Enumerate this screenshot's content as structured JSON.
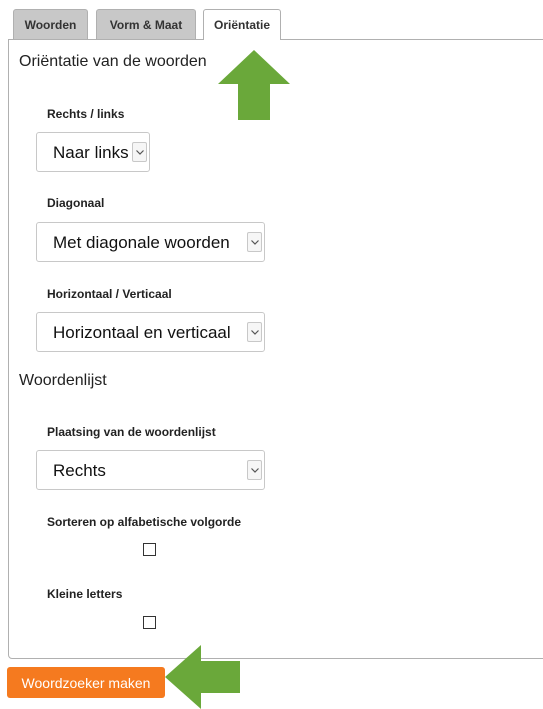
{
  "tabs": [
    {
      "label": "Woorden",
      "active": false
    },
    {
      "label": "Vorm & Maat",
      "active": false
    },
    {
      "label": "Oriëntatie",
      "active": true
    }
  ],
  "orientation": {
    "title": "Oriëntatie van de woorden",
    "right_left": {
      "label": "Rechts / links",
      "value": "Naar links"
    },
    "diagonal": {
      "label": "Diagonaal",
      "value": "Met diagonale woorden"
    },
    "horizontal_vertical": {
      "label": "Horizontaal / Verticaal",
      "value": "Horizontaal en verticaal"
    }
  },
  "word_list": {
    "title": "Woordenlijst",
    "placement": {
      "label": "Plaatsing van de woordenlijst",
      "value": "Rechts"
    },
    "sort_alpha": {
      "label": "Sorteren op alfabetische volgorde",
      "checked": false
    },
    "lowercase": {
      "label": "Kleine letters",
      "checked": false
    }
  },
  "make_button": {
    "label": "Woordzoeker maken",
    "color": "#f57a1f"
  },
  "annotation_arrows": {
    "color": "#6aa83a",
    "icons": [
      "arrow-up-icon",
      "arrow-left-icon"
    ]
  }
}
